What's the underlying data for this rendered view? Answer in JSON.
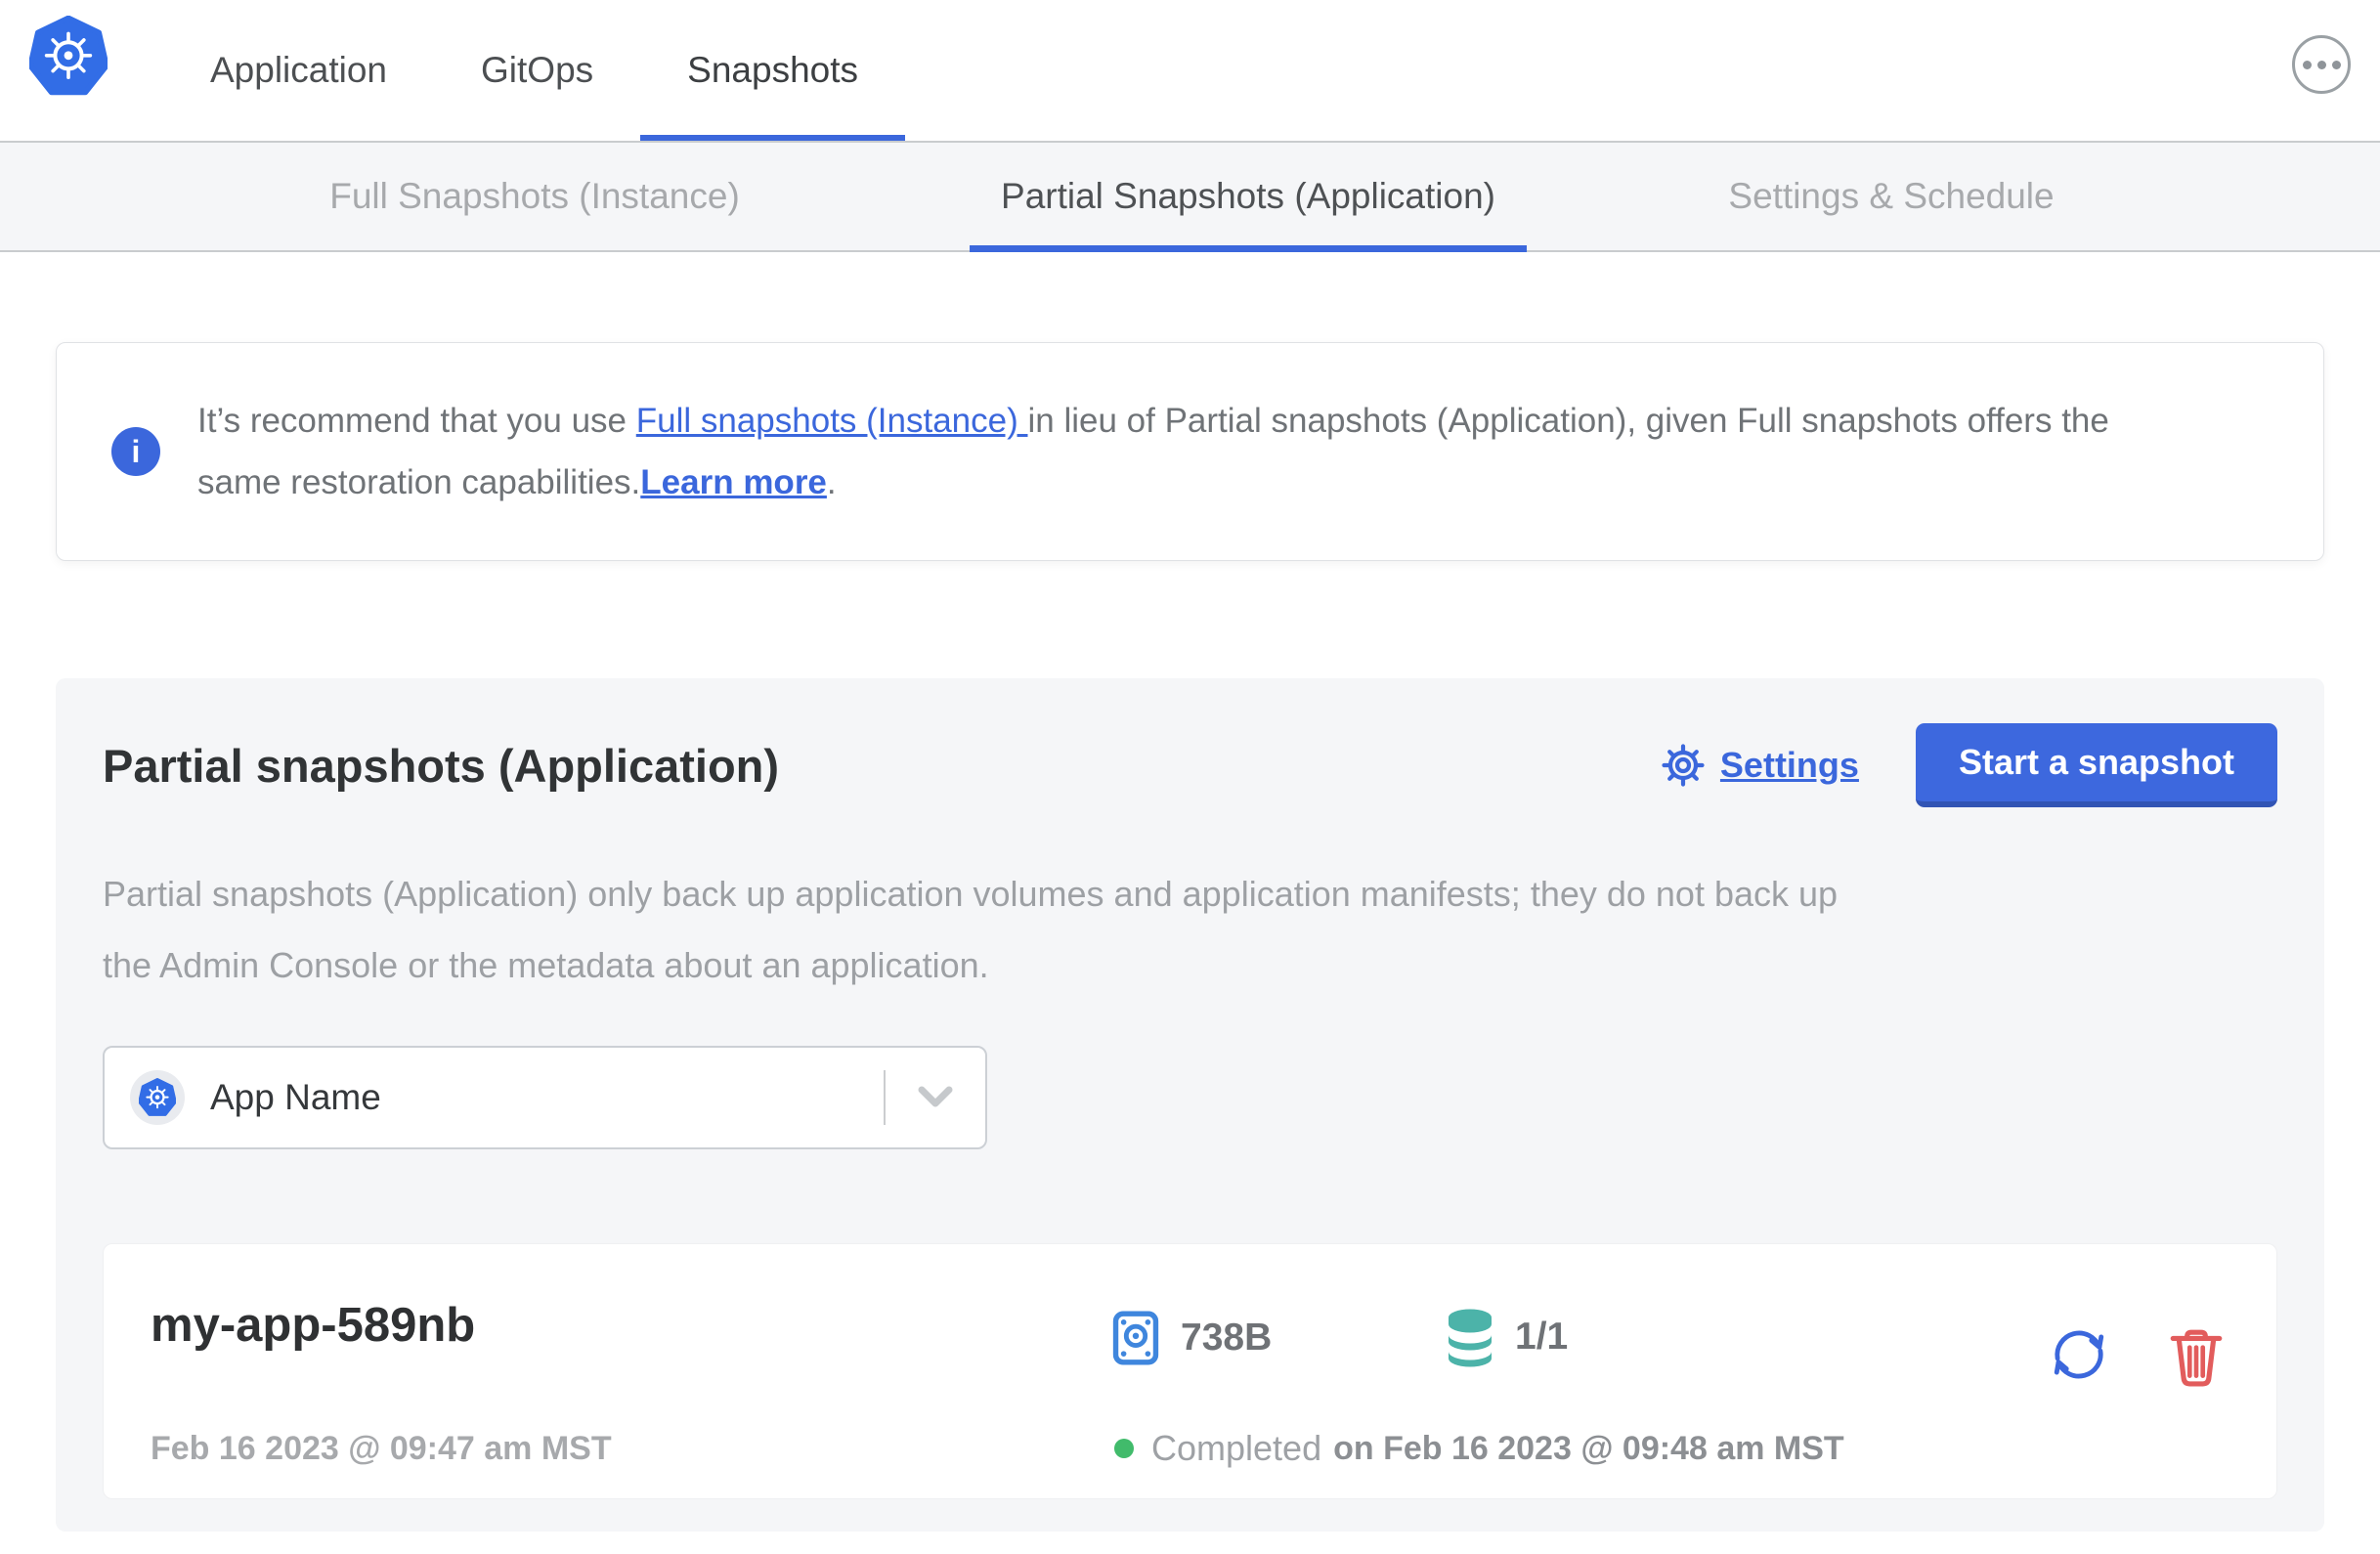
{
  "colors": {
    "accent_blue": "#3b67dc",
    "kubernetes_blue": "#326de6",
    "volume_teal": "#4cb3a9",
    "status_green": "#41bb6b",
    "danger_red": "#e25c5c"
  },
  "header": {
    "nav_items": [
      {
        "label": "Application"
      },
      {
        "label": "GitOps"
      },
      {
        "label": "Snapshots",
        "active": true
      }
    ]
  },
  "subnav": {
    "tabs": [
      {
        "label": "Full Snapshots (Instance)"
      },
      {
        "label": "Partial Snapshots (Application)",
        "active": true
      },
      {
        "label": "Settings & Schedule"
      }
    ]
  },
  "banner": {
    "info_glyph": "i",
    "line1": {
      "pre": "It’s recommend that you use ",
      "link": "Full snapshots (Instance) ",
      "post": "in lieu of Partial snapshots (Application), given Full snapshots offers the"
    },
    "line2": {
      "pre": "same restoration capabilities.",
      "link": "Learn more",
      "post": "."
    }
  },
  "panel": {
    "title": "Partial snapshots (Application)",
    "settings_label": "Settings",
    "start_button_label": "Start a snapshot",
    "description_lines": [
      "Partial snapshots (Application) only back up application volumes and application manifests; they do not back up",
      "the Admin Console or the metadata about an application."
    ],
    "app_selector": {
      "value": "App Name"
    },
    "snapshot": {
      "name": "my-app-589nb",
      "started": "Feb 16 2023 @ 09:47 am MST",
      "size": "738B",
      "volumes": "1/1",
      "status": "Completed",
      "finished": "on Feb 16 2023 @ 09:48 am MST"
    }
  }
}
